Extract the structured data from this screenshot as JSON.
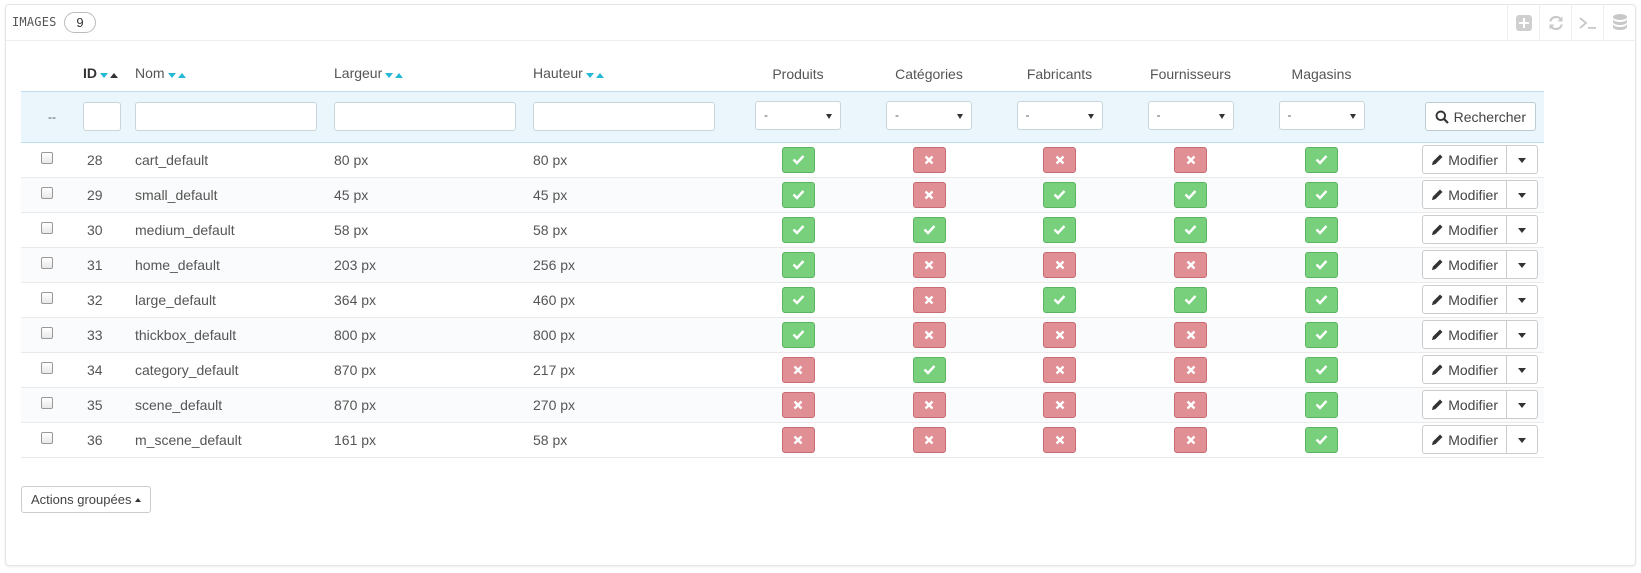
{
  "panel": {
    "title": "IMAGES",
    "count": "9"
  },
  "toolbar": [
    {
      "name": "add-icon"
    },
    {
      "name": "refresh-icon"
    },
    {
      "name": "terminal-icon"
    },
    {
      "name": "database-icon"
    }
  ],
  "columns": {
    "id": "ID",
    "name": "Nom",
    "width": "Largeur",
    "height": "Hauteur",
    "products": "Produits",
    "categories": "Catégories",
    "manufacturers": "Fabricants",
    "suppliers": "Fournisseurs",
    "stores": "Magasins"
  },
  "filter": {
    "placeholder_dash": "--",
    "select_value": "-",
    "search_label": "Rechercher"
  },
  "rows": [
    {
      "id": "28",
      "name": "cart_default",
      "width": "80 px",
      "height": "80 px",
      "products": true,
      "categories": false,
      "manufacturers": false,
      "suppliers": false,
      "stores": true
    },
    {
      "id": "29",
      "name": "small_default",
      "width": "45 px",
      "height": "45 px",
      "products": true,
      "categories": false,
      "manufacturers": true,
      "suppliers": true,
      "stores": true
    },
    {
      "id": "30",
      "name": "medium_default",
      "width": "58 px",
      "height": "58 px",
      "products": true,
      "categories": true,
      "manufacturers": true,
      "suppliers": true,
      "stores": true
    },
    {
      "id": "31",
      "name": "home_default",
      "width": "203 px",
      "height": "256 px",
      "products": true,
      "categories": false,
      "manufacturers": false,
      "suppliers": false,
      "stores": true
    },
    {
      "id": "32",
      "name": "large_default",
      "width": "364 px",
      "height": "460 px",
      "products": true,
      "categories": false,
      "manufacturers": true,
      "suppliers": true,
      "stores": true
    },
    {
      "id": "33",
      "name": "thickbox_default",
      "width": "800 px",
      "height": "800 px",
      "products": true,
      "categories": false,
      "manufacturers": false,
      "suppliers": false,
      "stores": true
    },
    {
      "id": "34",
      "name": "category_default",
      "width": "870 px",
      "height": "217 px",
      "products": false,
      "categories": true,
      "manufacturers": false,
      "suppliers": false,
      "stores": true
    },
    {
      "id": "35",
      "name": "scene_default",
      "width": "870 px",
      "height": "270 px",
      "products": false,
      "categories": false,
      "manufacturers": false,
      "suppliers": false,
      "stores": true
    },
    {
      "id": "36",
      "name": "m_scene_default",
      "width": "161 px",
      "height": "58 px",
      "products": false,
      "categories": false,
      "manufacturers": false,
      "suppliers": false,
      "stores": true
    }
  ],
  "row_action": {
    "edit_label": "Modifier"
  },
  "bulk": {
    "label": "Actions groupées"
  },
  "colors": {
    "ok": "#78d07d",
    "ko": "#e08f95",
    "sort": "#25b9d7",
    "filter_bg": "#eaf6fb"
  }
}
